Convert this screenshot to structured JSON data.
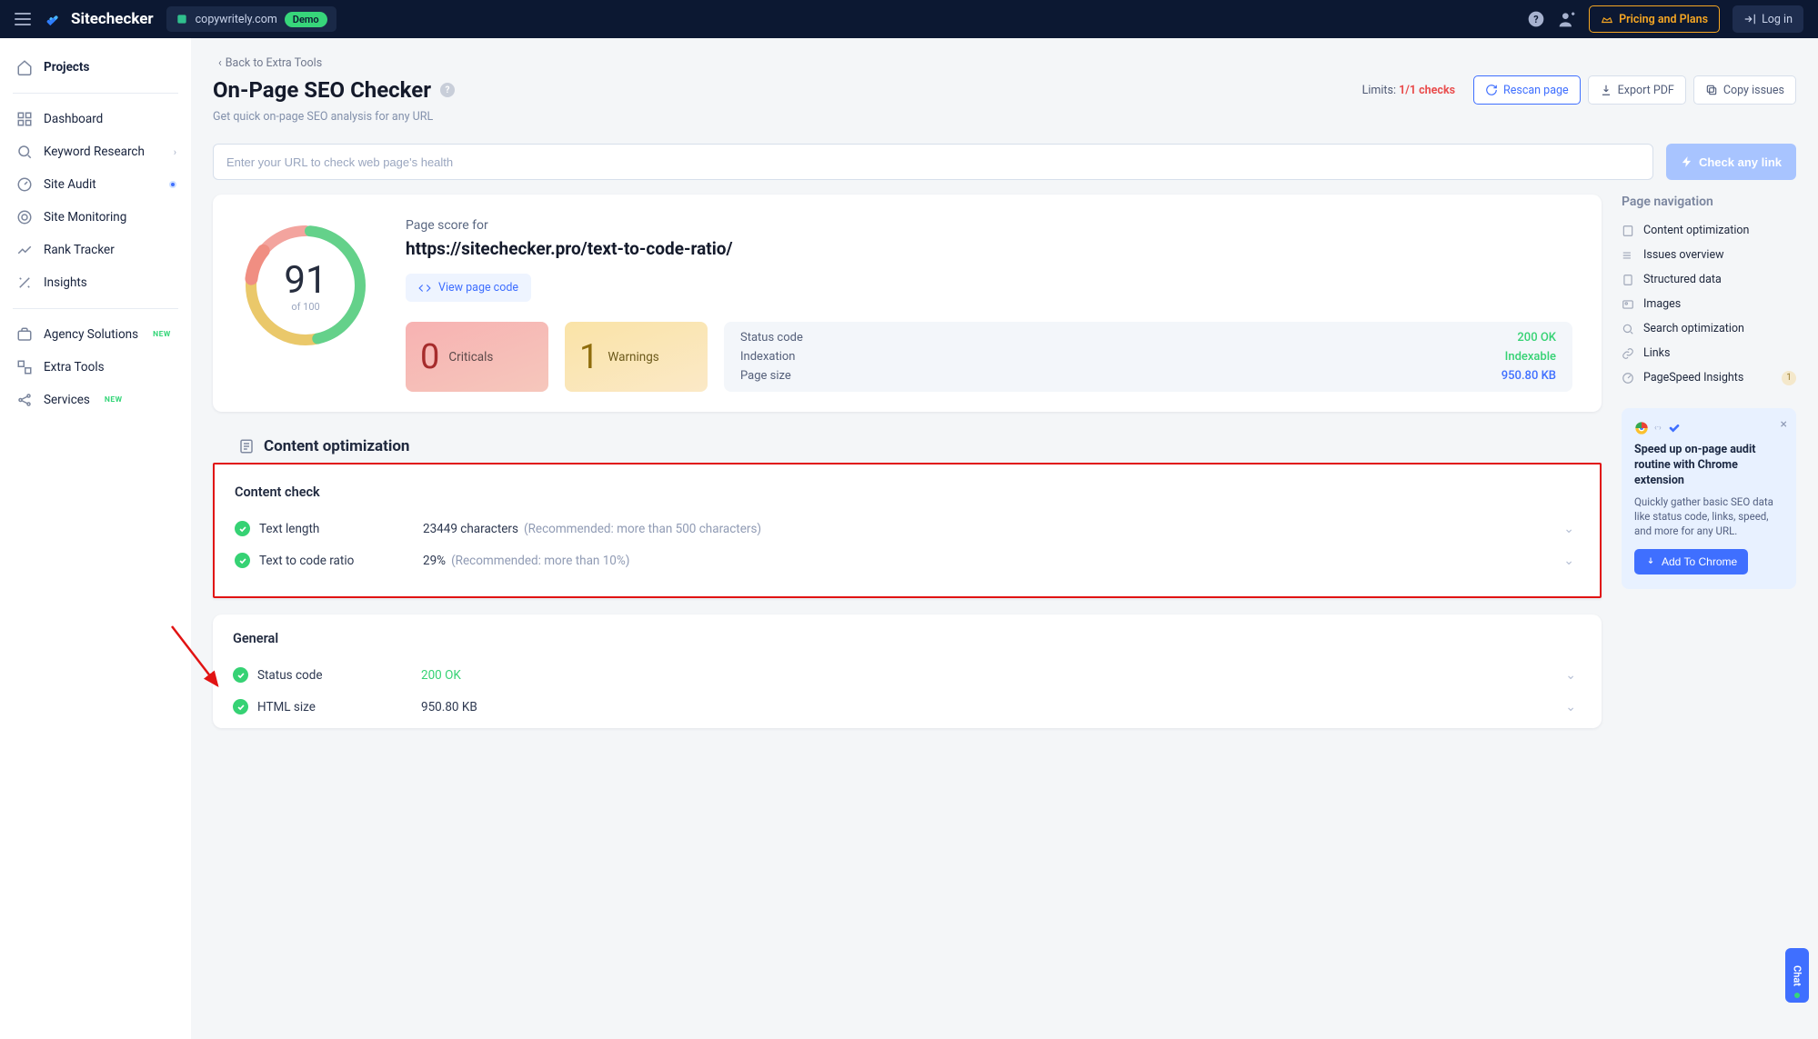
{
  "header": {
    "brand": "Sitechecker",
    "demo_domain": "copywritely.com",
    "demo_badge": "Demo",
    "pricing_label": "Pricing and Plans",
    "login_label": "Log in"
  },
  "sidebar": {
    "projects": "Projects",
    "items_main": [
      "Dashboard",
      "Keyword Research",
      "Site Audit",
      "Site Monitoring",
      "Rank Tracker",
      "Insights"
    ],
    "items_other": [
      "Agency Solutions",
      "Extra Tools",
      "Services"
    ],
    "new_indices_other": [
      0,
      2
    ]
  },
  "page": {
    "back_label": "Back to Extra Tools",
    "title": "On-Page SEO Checker",
    "subtitle": "Get quick on-page SEO analysis for any URL",
    "limits_prefix": "Limits:",
    "limits_value": "1/1 checks",
    "rescan_label": "Rescan page",
    "export_label": "Export PDF",
    "copy_label": "Copy issues",
    "url_placeholder": "Enter your URL to check web page's health",
    "check_btn": "Check any link"
  },
  "score": {
    "value": "91",
    "of_label": "of 100",
    "page_score_label": "Page score for",
    "page_url": "https://sitechecker.pro/text-to-code-ratio/",
    "view_code_label": "View page code",
    "kpi": {
      "criticals_count": "0",
      "criticals_label": "Criticals",
      "warnings_count": "1",
      "warnings_label": "Warnings"
    },
    "status": {
      "status_code_k": "Status code",
      "status_code_v": "200 OK",
      "indexation_k": "Indexation",
      "indexation_v": "Indexable",
      "pagesize_k": "Page size",
      "pagesize_v": "950.80 KB"
    }
  },
  "section_content_opt": "Content optimization",
  "content_check": {
    "heading": "Content check",
    "rows": {
      "text_length_name": "Text length",
      "text_length_val": "23449 characters",
      "text_length_rec": "(Recommended: more than 500 characters)",
      "ratio_name": "Text to code ratio",
      "ratio_val": "29%",
      "ratio_rec": "(Recommended: more than 10%)"
    }
  },
  "general": {
    "heading": "General",
    "rows": {
      "status_name": "Status code",
      "status_val": "200 OK",
      "html_name": "HTML size",
      "html_val": "950.80 KB"
    }
  },
  "page_nav": {
    "heading": "Page navigation",
    "items": [
      "Content optimization",
      "Issues overview",
      "Structured data",
      "Images",
      "Search optimization",
      "Links",
      "PageSpeed Insights"
    ],
    "pagespeed_badge": "1"
  },
  "promo": {
    "title": "Speed up on-page audit routine with Chrome extension",
    "body": "Quickly gather basic SEO data like status code, links, speed, and more for any URL.",
    "cta": "Add To Chrome"
  },
  "chat_label": "Chat"
}
